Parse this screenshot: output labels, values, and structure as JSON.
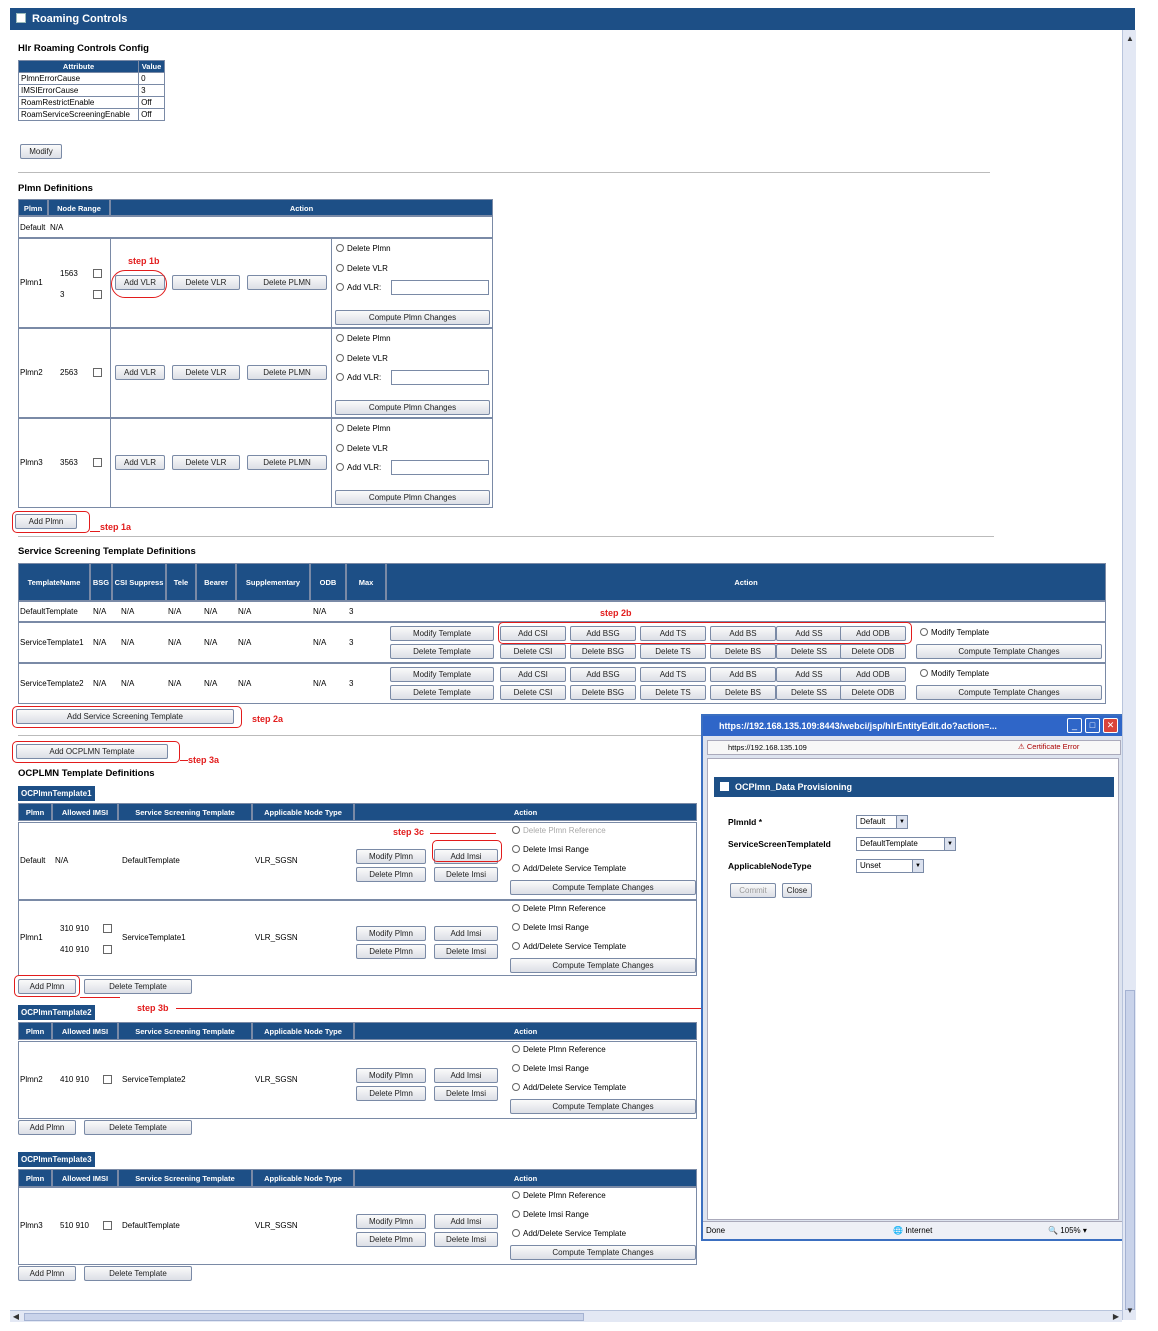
{
  "page": {
    "title": "Roaming Controls",
    "config_heading": "Hlr Roaming Controls Config",
    "modify_label": "Modify",
    "plmn_heading": "Plmn Definitions",
    "add_plmn_label": "Add Plmn",
    "sst_heading": "Service Screening Template Definitions",
    "add_sst_label": "Add Service Screening Template",
    "add_ocplmn_label": "Add OCPLMN Template",
    "ocplmn_heading": "OCPLMN Template Definitions"
  },
  "steps": {
    "s1a": "step 1a",
    "s1b": "step 1b",
    "s2a": "step 2a",
    "s2b": "step 2b",
    "s3a": "step 3a",
    "s3b": "step 3b",
    "s3c": "step 3c"
  },
  "config_table": {
    "headers": [
      "Attribute",
      "Value"
    ],
    "rows": [
      [
        "PlmnErrorCause",
        "0"
      ],
      [
        "IMSIErrorCause",
        "3"
      ],
      [
        "RoamRestrictEnable",
        "Off"
      ],
      [
        "RoamServiceScreeningEnable",
        "Off"
      ]
    ]
  },
  "plmn_table": {
    "headers": [
      "Plmn",
      "Node Range",
      "Action"
    ],
    "default_row": [
      "Default",
      "N/A"
    ],
    "rows": [
      {
        "name": "Plmn1",
        "ranges": [
          "1563",
          "3"
        ]
      },
      {
        "name": "Plmn2",
        "ranges": [
          "2563"
        ]
      },
      {
        "name": "Plmn3",
        "ranges": [
          "3563"
        ]
      }
    ],
    "buttons": {
      "add_vlr": "Add VLR",
      "delete_vlr": "Delete VLR",
      "delete_plmn": "Delete PLMN",
      "compute": "Compute Plmn Changes"
    },
    "radios": {
      "delete_plmn": "Delete Plmn",
      "delete_vlr": "Delete VLR",
      "add_vlr": "Add VLR:"
    }
  },
  "sst_table": {
    "headers": [
      "TemplateName",
      "BSG",
      "CSI Suppress Key",
      "Tele Service",
      "Bearer Service",
      "Supplementary Service",
      "ODB Service",
      "Max Camel Version",
      "Action"
    ],
    "rows": [
      [
        "DefaultTemplate",
        "N/A",
        "N/A",
        "N/A",
        "N/A",
        "N/A",
        "N/A",
        "3"
      ],
      [
        "ServiceTemplate1",
        "N/A",
        "N/A",
        "N/A",
        "N/A",
        "N/A",
        "N/A",
        "3"
      ],
      [
        "ServiceTemplate2",
        "N/A",
        "N/A",
        "N/A",
        "N/A",
        "N/A",
        "N/A",
        "3"
      ]
    ],
    "buttons": {
      "modify_template": "Modify Template",
      "delete_template": "Delete Template",
      "add_csi": "Add CSI",
      "delete_csi": "Delete CSI",
      "add_bsg": "Add BSG",
      "delete_bsg": "Delete BSG",
      "add_ts": "Add TS",
      "delete_ts": "Delete TS",
      "add_bs": "Add BS",
      "delete_bs": "Delete BS",
      "add_ss": "Add SS",
      "delete_ss": "Delete SS",
      "add_odb": "Add ODB",
      "delete_odb": "Delete ODB",
      "compute": "Compute Template Changes"
    },
    "radio_modify": "Modify Template"
  },
  "ocplmn": {
    "headers": [
      "Plmn",
      "Allowed IMSI",
      "Service Screening Template",
      "Applicable Node Type",
      "Action"
    ],
    "buttons": {
      "modify_plmn": "Modify Plmn",
      "delete_plmn": "Delete Plmn",
      "add_imsi": "Add Imsi",
      "delete_imsi": "Delete Imsi",
      "compute": "Compute Template Changes",
      "add_plmn": "Add Plmn",
      "delete_template": "Delete Template"
    },
    "radios": {
      "delete_ref": "Delete Plmn Reference",
      "delete_imsi_range": "Delete Imsi Range",
      "add_delete_sst": "Add/Delete Service Template"
    },
    "templates": [
      {
        "name": "OCPlmnTemplate1",
        "rows": [
          {
            "plmn": "Default",
            "imsi": [
              "N/A"
            ],
            "sst": "DefaultTemplate",
            "node": "VLR_SGSN"
          },
          {
            "plmn": "Plmn1",
            "imsi": [
              "310 910",
              "410 910"
            ],
            "sst": "ServiceTemplate1",
            "node": "VLR_SGSN"
          }
        ]
      },
      {
        "name": "OCPlmnTemplate2",
        "rows": [
          {
            "plmn": "Plmn2",
            "imsi": [
              "410 910"
            ],
            "sst": "ServiceTemplate2",
            "node": "VLR_SGSN"
          }
        ]
      },
      {
        "name": "OCPlmnTemplate3",
        "rows": [
          {
            "plmn": "Plmn3",
            "imsi": [
              "510 910"
            ],
            "sst": "DefaultTemplate",
            "node": "VLR_SGSN"
          }
        ]
      }
    ]
  },
  "popup": {
    "window_title": "https://192.168.135.109:8443/webci/jsp/hlrEntityEdit.do?action=...",
    "address": "https://192.168.135.109",
    "cert_error": "Certificate Error",
    "panel_title": "OCPlmn_Data Provisioning",
    "fields": [
      {
        "label": "PlmnId *",
        "value": "Default"
      },
      {
        "label": "ServiceScreenTemplateId",
        "value": "DefaultTemplate"
      },
      {
        "label": "ApplicableNodeType",
        "value": "Unset"
      }
    ],
    "commit": "Commit",
    "close": "Close",
    "status_done": "Done",
    "status_zone": "Internet",
    "zoom": "105%"
  }
}
